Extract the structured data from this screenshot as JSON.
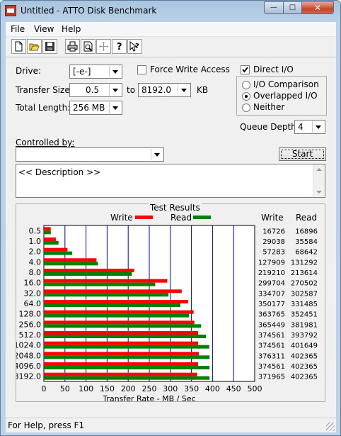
{
  "window": {
    "title": "Untitled - ATTO Disk Benchmark",
    "minimize": "—",
    "maximize": "□",
    "close": "✕"
  },
  "menu": [
    "File",
    "View",
    "Help"
  ],
  "toolbar_icons": [
    "new-icon",
    "open-icon",
    "save-icon",
    "print-icon",
    "print-preview-icon",
    "move-icon",
    "help-icon",
    "context-help-icon"
  ],
  "form": {
    "drive_label": "Drive:",
    "drive_value": "[-e-]",
    "force_write_label": "Force Write Access",
    "force_write_checked": false,
    "direct_io_label": "Direct I/O",
    "direct_io_checked": true,
    "transfer_size_label": "Transfer Size:",
    "transfer_from": "0.5",
    "to_label": "to",
    "transfer_to": "8192.0",
    "kb_label": "KB",
    "total_length_label": "Total Length:",
    "total_length_value": "256 MB",
    "io_options": [
      "I/O Comparison",
      "Overlapped I/O",
      "Neither"
    ],
    "io_selected": "Overlapped I/O",
    "queue_depth_label": "Queue Depth:",
    "queue_depth_value": "4",
    "controlled_by_label": "Controlled by:",
    "controlled_by_value": "",
    "start_label": "Start",
    "description": "<< Description >>"
  },
  "results": {
    "title": "Test Results",
    "write_label": "Write",
    "read_label": "Read",
    "write_col": "Write",
    "read_col": "Read",
    "rows": [
      {
        "size": "0.5",
        "write": "16726",
        "read": "16896"
      },
      {
        "size": "1.0",
        "write": "29038",
        "read": "35584"
      },
      {
        "size": "2.0",
        "write": "57283",
        "read": "68642"
      },
      {
        "size": "4.0",
        "write": "127909",
        "read": "131292"
      },
      {
        "size": "8.0",
        "write": "219210",
        "read": "213614"
      },
      {
        "size": "16.0",
        "write": "299704",
        "read": "270502"
      },
      {
        "size": "32.0",
        "write": "334707",
        "read": "302587"
      },
      {
        "size": "64.0",
        "write": "350177",
        "read": "331485"
      },
      {
        "size": "128.0",
        "write": "363765",
        "read": "352451"
      },
      {
        "size": "256.0",
        "write": "365449",
        "read": "381981"
      },
      {
        "size": "512.0",
        "write": "374561",
        "read": "393792"
      },
      {
        "size": "1024.0",
        "write": "374561",
        "read": "401649"
      },
      {
        "size": "2048.0",
        "write": "376311",
        "read": "402365"
      },
      {
        "size": "4096.0",
        "write": "374561",
        "read": "402365"
      },
      {
        "size": "8192.0",
        "write": "371965",
        "read": "402365"
      }
    ],
    "x_ticks": [
      "0",
      "50",
      "100",
      "150",
      "200",
      "250",
      "300",
      "350",
      "400",
      "450",
      "500"
    ],
    "x_label": "Transfer Rate - MB / Sec",
    "write_color": "#ff0000",
    "read_color": "#008000"
  },
  "chart_data": {
    "type": "bar",
    "orientation": "horizontal",
    "categories": [
      "0.5",
      "1.0",
      "2.0",
      "4.0",
      "8.0",
      "16.0",
      "32.0",
      "64.0",
      "128.0",
      "256.0",
      "512.0",
      "1024.0",
      "2048.0",
      "4096.0",
      "8192.0"
    ],
    "series": [
      {
        "name": "Write",
        "values": [
          16.3,
          28.4,
          55.9,
          124.9,
          214.1,
          292.7,
          326.9,
          342.0,
          355.2,
          356.9,
          365.8,
          365.8,
          367.5,
          365.8,
          363.2
        ]
      },
      {
        "name": "Read",
        "values": [
          16.5,
          34.8,
          67.0,
          128.2,
          208.6,
          264.2,
          295.5,
          323.7,
          344.2,
          373.0,
          384.6,
          392.2,
          392.9,
          392.9,
          392.9
        ]
      }
    ],
    "xlabel": "Transfer Rate - MB / Sec",
    "xlim": [
      0,
      500
    ],
    "grid": true,
    "legend": "top"
  },
  "status": {
    "text": "For Help, press F1"
  }
}
